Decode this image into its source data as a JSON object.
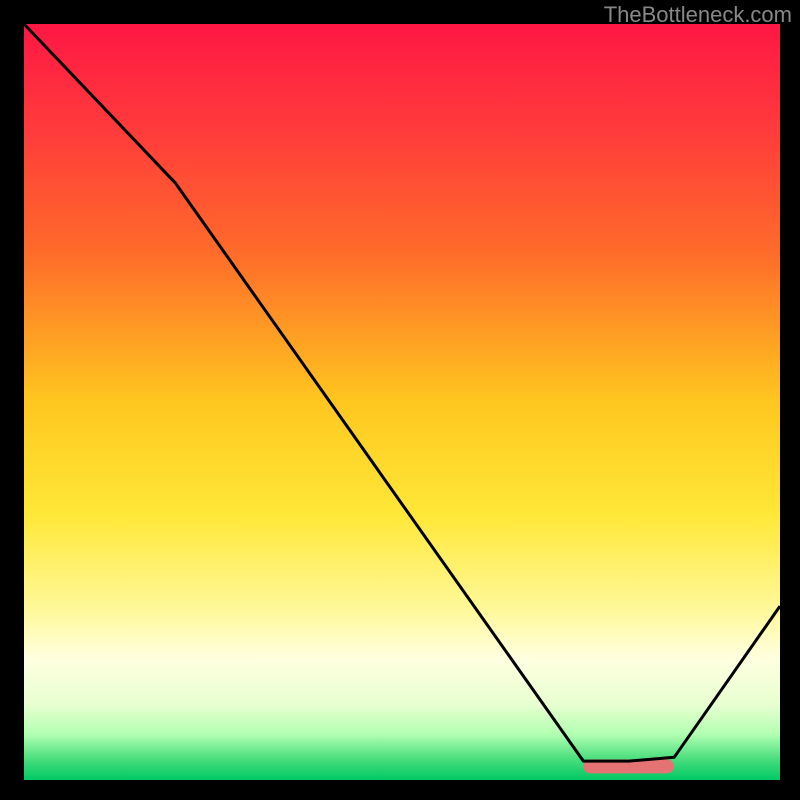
{
  "attribution": "TheBottleneck.com",
  "chart_data": {
    "type": "line",
    "title": "",
    "xlabel": "",
    "ylabel": "",
    "xlim": [
      0,
      100
    ],
    "ylim": [
      0,
      100
    ],
    "background_gradient": {
      "stops": [
        {
          "offset": 0,
          "color": "#ff1744"
        },
        {
          "offset": 14,
          "color": "#ff3b3b"
        },
        {
          "offset": 30,
          "color": "#ff6a2a"
        },
        {
          "offset": 50,
          "color": "#ffc71f"
        },
        {
          "offset": 65,
          "color": "#ffe838"
        },
        {
          "offset": 78,
          "color": "#fff99e"
        },
        {
          "offset": 84,
          "color": "#ffffe0"
        },
        {
          "offset": 90,
          "color": "#e8ffd0"
        },
        {
          "offset": 94,
          "color": "#b0ffb0"
        },
        {
          "offset": 97,
          "color": "#50e080"
        },
        {
          "offset": 100,
          "color": "#00c864"
        }
      ]
    },
    "series": [
      {
        "name": "bottleneck-curve",
        "x": [
          0,
          20,
          74,
          80,
          86,
          100
        ],
        "values": [
          100,
          79,
          2.5,
          2.5,
          3,
          23
        ]
      }
    ],
    "marker": {
      "x_start": 74,
      "x_end": 86,
      "y": 1.8,
      "color": "#e57373"
    }
  }
}
